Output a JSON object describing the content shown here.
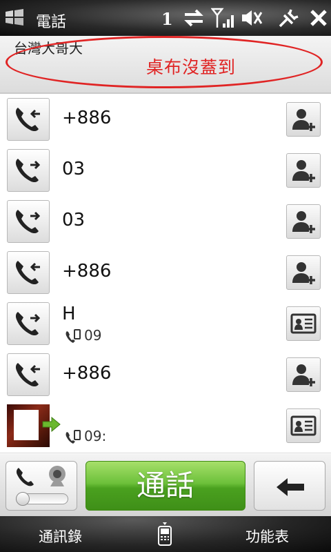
{
  "status_bar": {
    "app_title": "電話",
    "notification_count": "1"
  },
  "carrier": {
    "name": "台灣大哥大"
  },
  "annotation": {
    "text": "桌布沒蓋到",
    "color": "#e02424"
  },
  "call_log": [
    {
      "direction": "incoming",
      "number": "+886",
      "action": "add-contact"
    },
    {
      "direction": "outgoing",
      "number": "03",
      "action": "add-contact"
    },
    {
      "direction": "outgoing",
      "number": "03",
      "action": "add-contact"
    },
    {
      "direction": "incoming",
      "number": "+886",
      "action": "add-contact"
    },
    {
      "direction": "outgoing",
      "name": "H",
      "sub_number": "09",
      "action": "contact-card"
    },
    {
      "direction": "incoming",
      "number": "+886",
      "action": "add-contact"
    },
    {
      "direction": "outgoing",
      "name": "",
      "sub_number": "09:",
      "action": "contact-card"
    }
  ],
  "controls": {
    "talk_label": "通話",
    "accent": "#5cb52c"
  },
  "softkeys": {
    "left": "通訊錄",
    "right": "功能表"
  }
}
